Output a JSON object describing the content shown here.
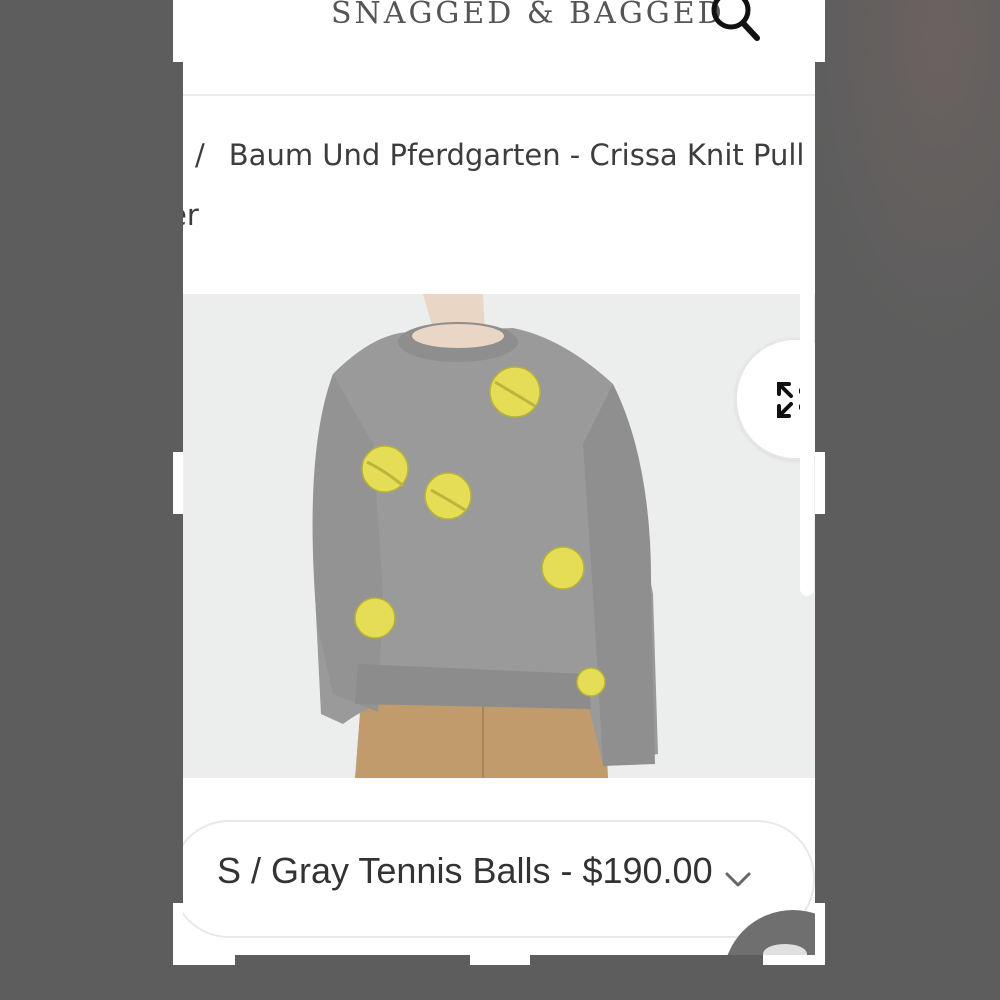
{
  "store": {
    "name": "SNAGGED & BAGGED"
  },
  "breadcrumb": {
    "separator": "/",
    "product_title_line1": "Baum Und Pferdgarten - Crissa Knit Pull C",
    "product_title_line2": "er"
  },
  "product": {
    "image_alt": "Gray knit sweater with yellow tennis ball pattern",
    "variant_selected": "S / Gray Tennis Balls - $190.00"
  },
  "icons": {
    "search": "search-icon",
    "expand": "expand-icon",
    "chevron": "chevron-down-icon",
    "chat": "chat-icon"
  },
  "colors": {
    "sweater": "#9a9a9a",
    "tennis_ball": "#e4dd55",
    "trousers": "#c19b6c",
    "backdrop": "#5d5d5d"
  }
}
